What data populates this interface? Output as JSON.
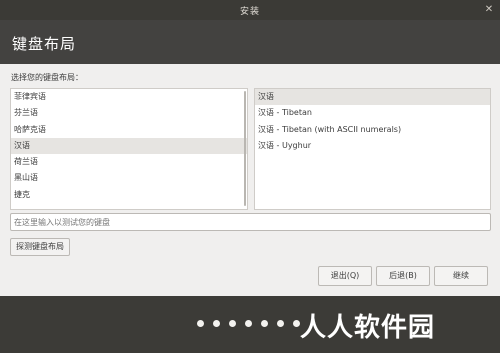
{
  "window": {
    "title": "安装"
  },
  "header": {
    "title": "键盘布局"
  },
  "layout_prompt": "选择您的键盘布局：",
  "layouts": [
    "菲律宾语",
    "芬兰语",
    "哈萨克语",
    "汉语",
    "荷兰语",
    "黑山语",
    "捷克"
  ],
  "layout_selected_index": 3,
  "variants": [
    "汉语",
    "汉语 - Tibetan",
    "汉语 - Tibetan (with ASCII numerals)",
    "汉语 - Uyghur"
  ],
  "variant_selected_index": 0,
  "test_input": {
    "placeholder": "在这里输入以测试您的键盘",
    "value": ""
  },
  "detect_button": "探测键盘布局",
  "buttons": {
    "quit": "退出(Q)",
    "back": "后退(B)",
    "continue": "继续"
  },
  "progress": {
    "total_steps": 7,
    "current_step": 7
  },
  "watermark": "人人软件园",
  "colors": {
    "header_bg": "#434240",
    "titlebar_bg": "#3b3a36",
    "window_bg": "#f0efee",
    "selection_bg": "#e6e4e1"
  }
}
